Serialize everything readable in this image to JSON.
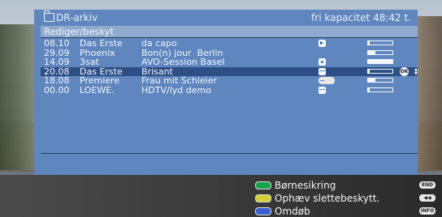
{
  "header": {
    "title": "DR-arkiv",
    "capacity": "fri kapacitet 48:42 t."
  },
  "subheader": "Rediger/beskyt",
  "recordings": [
    {
      "date": "08.10",
      "channel": "Das Erste",
      "title": "da capo",
      "icon": "play-icon",
      "progress": 0.05
    },
    {
      "date": "29.09",
      "channel": "Phoenix",
      "title": "Bon(n) jour  Berlin",
      "icon": "",
      "progress": 0.3
    },
    {
      "date": "14.09",
      "channel": "3sat",
      "title": "AVO-Session Basel",
      "icon": "lock-icon",
      "progress": 1.0
    },
    {
      "date": "20.08",
      "channel": "Das Erste",
      "title": "Brisant",
      "icon": "tape-icon",
      "progress": 0.05
    },
    {
      "date": "18.08",
      "channel": "Premiere",
      "title": "Frau mit Schleier",
      "icon": "key-icon",
      "progress": 0.3
    },
    {
      "date": "00.00",
      "channel": "LOEWE.",
      "title": "HDTV/lyd demo",
      "icon": "tape-icon",
      "progress": 0.05
    }
  ],
  "selected_row": 3,
  "ok_label": "OK",
  "menu": [
    {
      "color": "#1aa34a",
      "label": "Børnesikring",
      "key": "END"
    },
    {
      "color": "#d4cf35",
      "label": "Ophæv slettebeskytt.",
      "key": "◀◀"
    },
    {
      "color": "#3a5fd0",
      "label": "Omdøb",
      "key": "INFO"
    }
  ]
}
